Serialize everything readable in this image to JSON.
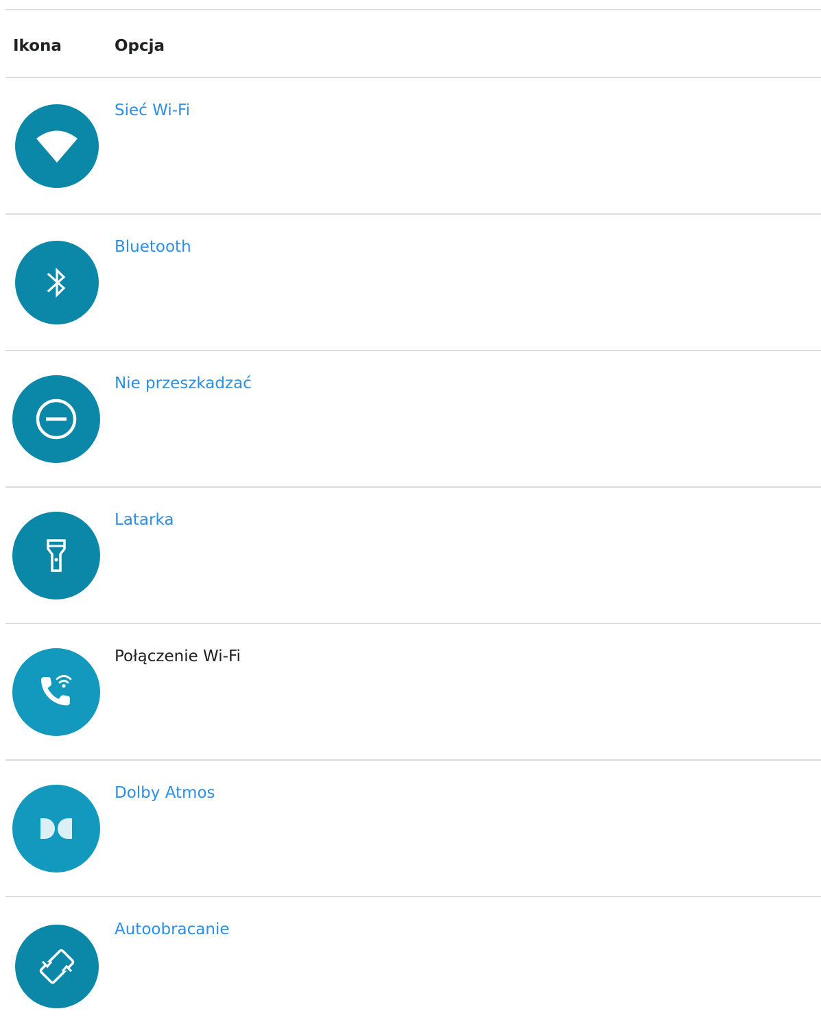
{
  "table": {
    "headers": {
      "icon": "Ikona",
      "option": "Opcja"
    },
    "rows": [
      {
        "label": "Sieć Wi-Fi",
        "icon": "wifi-icon",
        "is_link": true,
        "circle_color": "#0b87a8"
      },
      {
        "label": "Bluetooth",
        "icon": "bluetooth-icon",
        "is_link": true,
        "circle_color": "#0b87a8"
      },
      {
        "label": "Nie przeszkadzać",
        "icon": "do-not-disturb-icon",
        "is_link": true,
        "circle_color": "#0b87a8"
      },
      {
        "label": "Latarka",
        "icon": "flashlight-icon",
        "is_link": true,
        "circle_color": "#0b87a8"
      },
      {
        "label": "Połączenie Wi-Fi",
        "icon": "wifi-calling-icon",
        "is_link": false,
        "circle_color": "#1399bd"
      },
      {
        "label": "Dolby Atmos",
        "icon": "dolby-atmos-icon",
        "is_link": true,
        "circle_color": "#1399bd"
      },
      {
        "label": "Autoobracanie",
        "icon": "auto-rotate-icon",
        "is_link": true,
        "circle_color": "#0b87a8"
      }
    ]
  },
  "colors": {
    "link": "#2b8fe6",
    "divider": "#dadce0",
    "icon_glyph": "#ffffff"
  }
}
